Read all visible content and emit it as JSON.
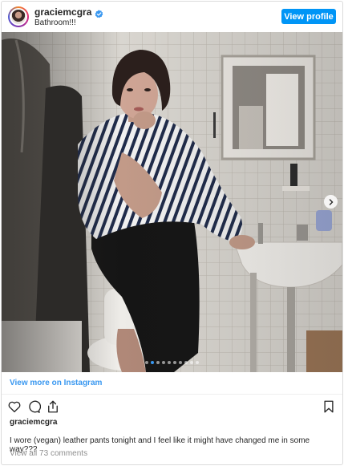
{
  "header": {
    "username": "graciemcgra",
    "location": "Bathroom!!!",
    "verified_icon": "verified-badge-icon",
    "view_profile_label": "View profile"
  },
  "post": {
    "photo_alt": "Woman in striped shirt and black leather pants posing on a sink in a tiled bathroom",
    "carousel": {
      "total_slides": 10,
      "active_slide": 2
    },
    "next_icon": "chevron-right-icon"
  },
  "footer": {
    "view_more_label": "View more on Instagram",
    "action_icons": [
      "heart-icon",
      "comment-icon",
      "share-icon",
      "bookmark-icon"
    ],
    "owner_username": "graciemcgra",
    "caption": "I wore (vegan) leather pants tonight and I feel like it might have changed me in some way???",
    "comments_link": "View all 73 comments"
  },
  "colors": {
    "button_blue": "#0095f6",
    "link_blue": "#3897f0",
    "muted_text": "#8e8e8e",
    "border": "#dbdbdb"
  }
}
